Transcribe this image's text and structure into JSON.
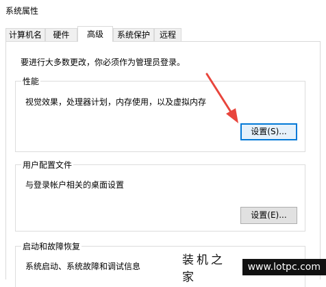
{
  "window": {
    "title": "系统属性"
  },
  "tabs": [
    {
      "label": "计算机名"
    },
    {
      "label": "硬件"
    },
    {
      "label": "高级"
    },
    {
      "label": "系统保护"
    },
    {
      "label": "远程"
    }
  ],
  "active_tab": "高级",
  "notice": "要进行大多数更改，你必须作为管理员登录。",
  "performance": {
    "title": "性能",
    "description": "视觉效果，处理器计划，内存使用，以及虚拟内存",
    "button": "设置(S)..."
  },
  "user_profiles": {
    "title": "用户配置文件",
    "description": "与登录帐户相关的桌面设置",
    "button": "设置(E)..."
  },
  "startup_recovery": {
    "title": "启动和故障恢复",
    "description": "系统启动、系统故障和调试信息"
  },
  "watermark": {
    "chinese": "装机之家",
    "url": "www.lotpc.com"
  },
  "colors": {
    "arrow": "#e8453c",
    "focus_border": "#0078d7",
    "button_bg": "#e1e1e1",
    "panel_border": "#d9d9d9"
  }
}
